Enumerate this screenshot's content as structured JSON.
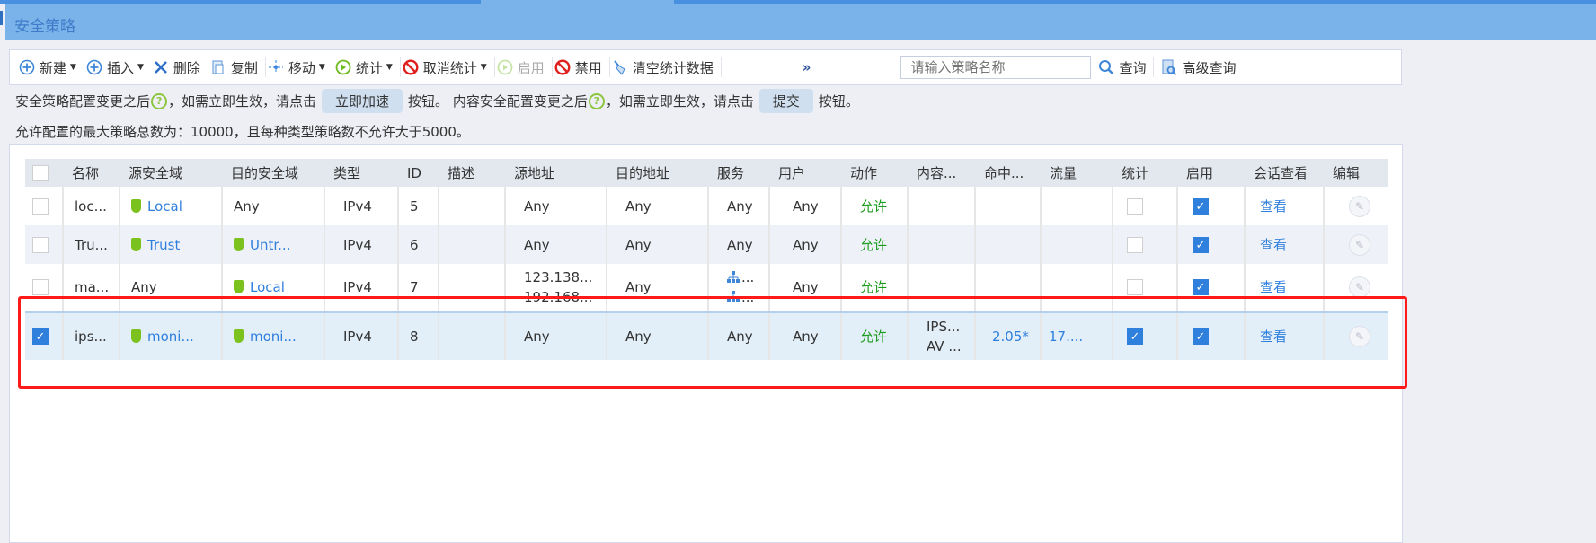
{
  "window": {
    "title": "安全策略"
  },
  "toolbar": {
    "items": [
      {
        "label": "新建",
        "icon": "plus-circle-icon",
        "dropdown": true
      },
      {
        "label": "插入",
        "icon": "plus-circle-icon",
        "dropdown": true
      },
      {
        "label": "删除",
        "icon": "x-icon",
        "dropdown": false
      },
      {
        "label": "复制",
        "icon": "copy-icon",
        "dropdown": false
      },
      {
        "label": "移动",
        "icon": "move-icon",
        "dropdown": true
      },
      {
        "label": "统计",
        "icon": "play-circle-icon",
        "dropdown": true
      },
      {
        "label": "取消统计",
        "icon": "ban-icon",
        "dropdown": true
      },
      {
        "label": "启用",
        "icon": "play-circle-icon",
        "dropdown": false,
        "disabled": true
      },
      {
        "label": "禁用",
        "icon": "ban-icon",
        "dropdown": false
      },
      {
        "label": "清空统计数据",
        "icon": "broom-icon",
        "dropdown": false
      }
    ],
    "more": "»",
    "search_placeholder": "请输入策略名称",
    "query": "查询",
    "advanced_query": "高级查询"
  },
  "info": {
    "line1_a": "安全策略配置变更之后",
    "line1_b": "，如需立即生效，请点击",
    "btn1": "立即加速",
    "line1_c": "按钮。 内容安全配置变更之后",
    "line1_d": "，如需立即生效，请点击",
    "btn2": "提交",
    "line1_e": "按钮。",
    "help": "?",
    "line2": "允许配置的最大策略总数为：10000，且每种类型策略数不允许大于5000。"
  },
  "table": {
    "columns": [
      "名称",
      "源安全域",
      "目的安全域",
      "类型",
      "ID",
      "描述",
      "源地址",
      "目的地址",
      "服务",
      "用户",
      "动作",
      "内容...",
      "命中...",
      "流量",
      "统计",
      "启用",
      "会话查看",
      "编辑"
    ],
    "rows": [
      {
        "selected": false,
        "name": "loc...",
        "src_zone": "Local",
        "dst_zone": "Any",
        "type": "IPv4",
        "id": "5",
        "desc": "",
        "src_addr": [
          "Any"
        ],
        "dst_addr": "Any",
        "service": [
          "Any"
        ],
        "user": "Any",
        "action": "允许",
        "content": [],
        "hits": "",
        "traffic": "",
        "stats": false,
        "enabled": true,
        "session": "查看"
      },
      {
        "selected": false,
        "name": "Tru...",
        "src_zone": "Trust",
        "dst_zone": "Untr...",
        "type": "IPv4",
        "id": "6",
        "desc": "",
        "src_addr": [
          "Any"
        ],
        "dst_addr": "Any",
        "service": [
          "Any"
        ],
        "user": "Any",
        "action": "允许",
        "content": [],
        "hits": "",
        "traffic": "",
        "stats": false,
        "enabled": true,
        "session": "查看"
      },
      {
        "selected": false,
        "name": "ma...",
        "src_zone": "Any",
        "dst_zone": "Local",
        "type": "IPv4",
        "id": "7",
        "desc": "",
        "src_addr": [
          "123.138...",
          "192.168..."
        ],
        "dst_addr": "Any",
        "service": [
          "...",
          "..."
        ],
        "user": "Any",
        "action": "允许",
        "content": [],
        "hits": "",
        "traffic": "",
        "stats": false,
        "enabled": true,
        "session": "查看"
      },
      {
        "selected": true,
        "name": "ips...",
        "src_zone": "moni...",
        "dst_zone": "moni...",
        "type": "IPv4",
        "id": "8",
        "desc": "",
        "src_addr": [
          "Any"
        ],
        "dst_addr": "Any",
        "service": [
          "Any"
        ],
        "user": "Any",
        "action": "允许",
        "content": [
          "IPS...",
          "AV ..."
        ],
        "hits": "2.05*",
        "traffic": "17....",
        "stats": true,
        "enabled": true,
        "session": "查看"
      }
    ]
  },
  "colors": {
    "accent": "#2f7fdd",
    "title_bar": "#7ab3ea",
    "allow": "#1a9a1a",
    "zone_shield": "#7cc21e",
    "highlight_box": "#ff1a1a"
  }
}
